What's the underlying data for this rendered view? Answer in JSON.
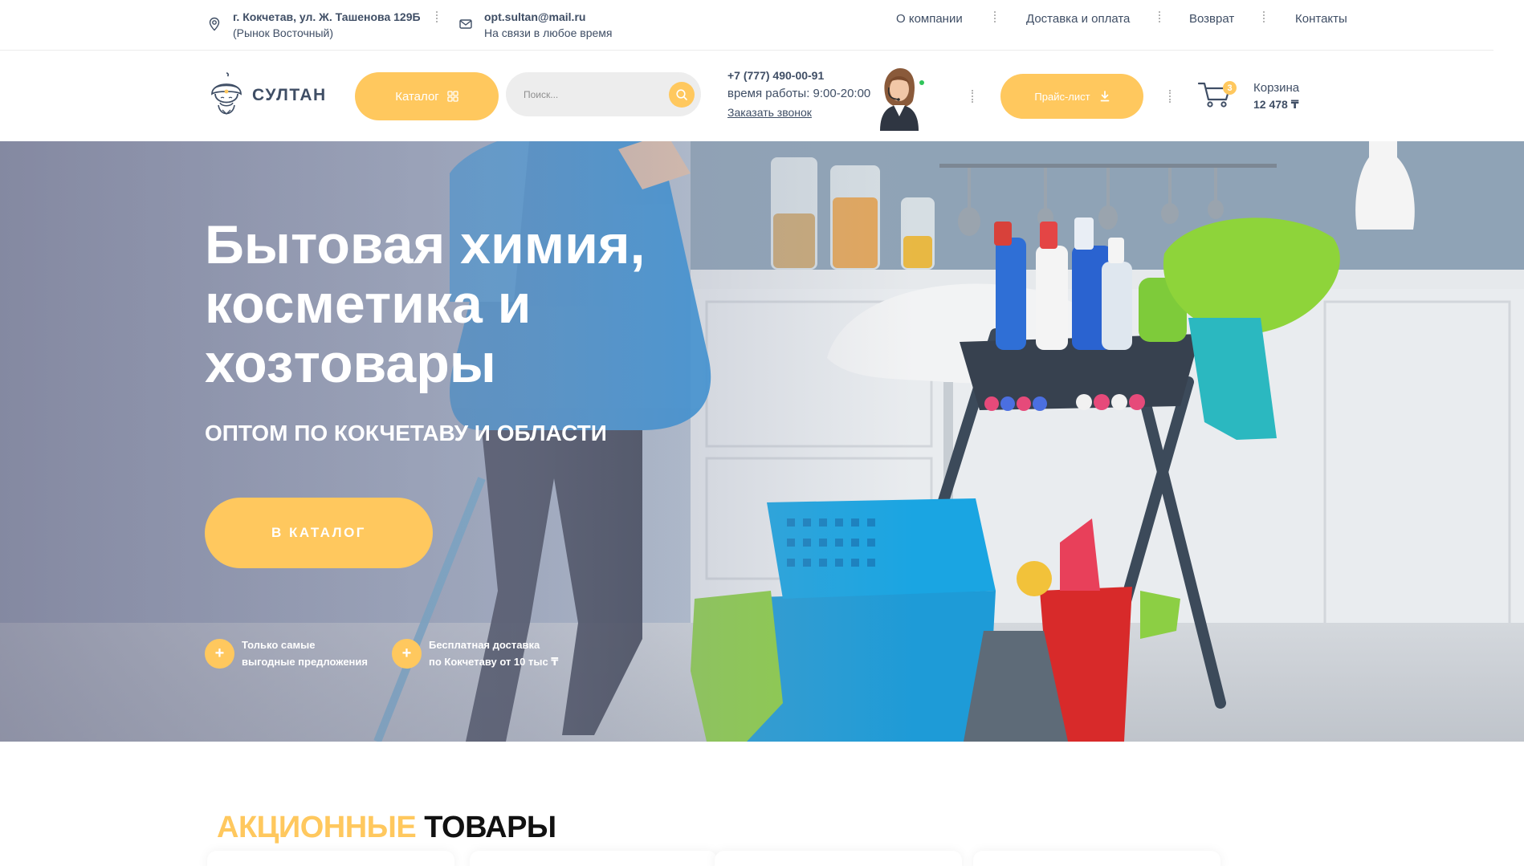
{
  "topbar": {
    "address_line1": "г. Кокчетав, ул. Ж. Ташенова 129Б",
    "address_line2": "(Рынок Восточный)",
    "email": "opt.sultan@mail.ru",
    "email_note": "На связи в любое время",
    "nav": [
      "О компании",
      "Доставка и оплата",
      "Возврат",
      "Контакты"
    ]
  },
  "header": {
    "logo_text": "СУЛТАН",
    "catalog_label": "Каталог",
    "search_placeholder": "Поиск...",
    "phone": "+7 (777) 490-00-91",
    "hours": "время работы: 9:00-20:00",
    "callback_label": "Заказать звонок",
    "price_list_label": "Прайс-лист",
    "cart_label": "Корзина",
    "cart_count": "3",
    "cart_total": "12 478 ₸"
  },
  "hero": {
    "title": "Бытовая химия, косметика и хозтовары",
    "subtitle": "ОПТОМ ПО КОКЧЕТАВУ И ОБЛАСТИ",
    "button_label": "В КАТАЛОГ",
    "features": [
      {
        "line1": "Только самые",
        "line2": "выгодные предложения"
      },
      {
        "line1": "Бесплатная доставка",
        "line2": "по Кокчетаву от 10 тыс ₸"
      }
    ]
  },
  "promo": {
    "title_accent": "АКЦИОННЫЕ",
    "title_rest": "ТОВАРЫ"
  },
  "colors": {
    "accent": "#ffc85e",
    "text": "#3f4e65",
    "online": "#2fc45a"
  },
  "icons": [
    "location-pin-icon",
    "mail-icon",
    "grid-icon",
    "search-icon",
    "download-icon",
    "cart-icon",
    "plus-icon"
  ]
}
